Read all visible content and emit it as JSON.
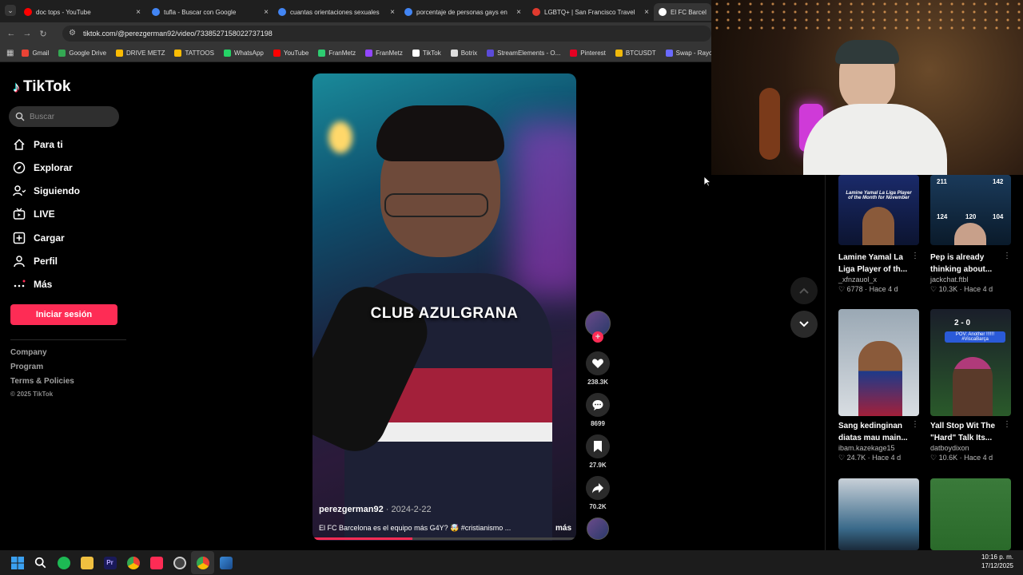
{
  "browser": {
    "tabs": [
      {
        "title": "doc tops - YouTube",
        "icon": "youtube-icon",
        "color": "#ff0000"
      },
      {
        "title": "tufla - Buscar con Google",
        "icon": "google-icon",
        "color": "#4285f4"
      },
      {
        "title": "cuantas orientaciones sexuales",
        "icon": "google-icon",
        "color": "#4285f4"
      },
      {
        "title": "porcentaje de personas gays en",
        "icon": "google-icon",
        "color": "#4285f4"
      },
      {
        "title": "LGBTQ+ | San Francisco Travel",
        "icon": "sftravel-icon",
        "color": "#e03a2e"
      },
      {
        "title": "El FC Barcelon",
        "icon": "tiktok-icon",
        "color": "#ffffff"
      }
    ],
    "url": "tiktok.com/@perezgerman92/video/7338527158022737198",
    "bookmarks": [
      {
        "label": "Gmail",
        "color": "#ea4335"
      },
      {
        "label": "Google Drive",
        "color": "#34a853"
      },
      {
        "label": "DRIVE METZ",
        "color": "#fbbc04"
      },
      {
        "label": "TATTOOS",
        "color": "#fbbc04"
      },
      {
        "label": "WhatsApp",
        "color": "#25d366"
      },
      {
        "label": "YouTube",
        "color": "#ff0000"
      },
      {
        "label": "FranMetz",
        "color": "#2ecc71"
      },
      {
        "label": "FranMetz",
        "color": "#9146ff"
      },
      {
        "label": "TikTok",
        "color": "#ffffff"
      },
      {
        "label": "Botrix",
        "color": "#dddddd"
      },
      {
        "label": "StreamElements - O...",
        "color": "#5b4bd8"
      },
      {
        "label": "Pinterest",
        "color": "#e60023"
      },
      {
        "label": "BTCUSDT",
        "color": "#f0b90b"
      },
      {
        "label": "Swap - Rayo",
        "color": "#6a6aff"
      }
    ]
  },
  "sidebar": {
    "logo": "TikTok",
    "search_placeholder": "Buscar",
    "items": [
      {
        "label": "Para ti",
        "icon": "home-icon"
      },
      {
        "label": "Explorar",
        "icon": "compass-icon"
      },
      {
        "label": "Siguiendo",
        "icon": "following-icon"
      },
      {
        "label": "LIVE",
        "icon": "live-icon"
      },
      {
        "label": "Cargar",
        "icon": "upload-icon"
      },
      {
        "label": "Perfil",
        "icon": "profile-icon"
      },
      {
        "label": "Más",
        "icon": "more-icon"
      }
    ],
    "login_label": "Iniciar sesión",
    "footer": [
      "Company",
      "Program",
      "Terms & Policies"
    ],
    "copyright": "© 2025 TikTok"
  },
  "video": {
    "caption_overlay": "CLUB AZULGRANA",
    "author": "perezgerman92",
    "date": " · 2024-2-22",
    "description": "El FC Barcelona es el equipo más G4Y? 🤯 #cristianismo ...",
    "more_label": "más",
    "progress": 0.38,
    "likes": "238.3K",
    "comments": "8699",
    "saves": "27.9K",
    "shares": "70.2K"
  },
  "recommendations": [
    {
      "title": "Lamine Yamal La Liga Player of th...",
      "author": "_xfnzauol_x",
      "likes": "6778",
      "age": "Hace 4 d"
    },
    {
      "title": "Pep is already thinking about...",
      "author": "jackchat.ftbl",
      "likes": "10.3K",
      "age": "Hace 4 d"
    },
    {
      "title": "Sang kedinginan diatas mau main...",
      "author": "ibam.kazekage15",
      "likes": "24.7K",
      "age": "Hace 4 d"
    },
    {
      "title": "Yall Stop Wit The \"Hard\" Talk Its...",
      "author": "datboydixon",
      "likes": "10.6K",
      "age": "Hace 4 d"
    }
  ],
  "thumb_text": {
    "yamal": "Lamine Yamal La Liga Player of the Month for November",
    "pep_stats": [
      "211",
      "142",
      "124",
      "120",
      "104"
    ],
    "score": "2 - 0",
    "pov": "POV: Another !!!!!! #ViscaBarça"
  },
  "taskbar": {
    "time": "10:16 p. m.",
    "date": "17/12/2025"
  }
}
